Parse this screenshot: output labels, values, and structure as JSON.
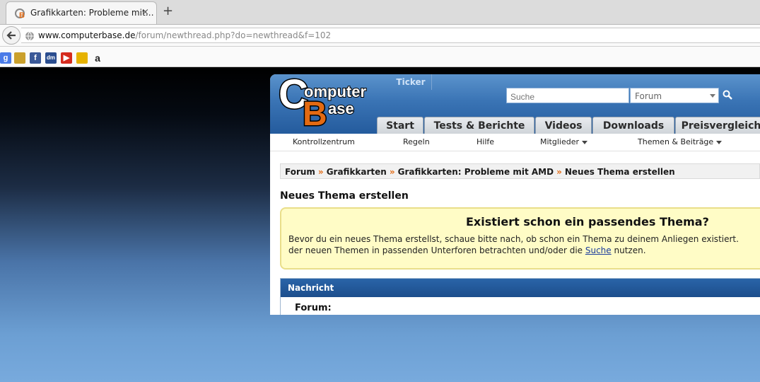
{
  "browser": {
    "tab_title": "Grafikkarten: Probleme mit…",
    "tab_close": "×",
    "new_tab": "+",
    "url_host": "www.computerbase.de",
    "url_path": "/forum/newthread.php?do=newthread&f=102",
    "bookmarks": [
      {
        "name": "google",
        "glyph": "g",
        "color": "#4a7be8"
      },
      {
        "name": "museum",
        "glyph": "",
        "color": "#caa02c"
      },
      {
        "name": "facebook",
        "glyph": "f",
        "color": "#3b5998"
      },
      {
        "name": "dm",
        "glyph": "dm",
        "color": "#2a4d8f"
      },
      {
        "name": "youtube",
        "glyph": "▶",
        "color": "#d52b1e"
      },
      {
        "name": "shop",
        "glyph": "",
        "color": "#e6b200"
      },
      {
        "name": "amazon",
        "glyph": "a",
        "color": "#222222"
      }
    ]
  },
  "site": {
    "logo_line1": "omputer",
    "logo_line2": "ase",
    "ticker": "Ticker",
    "search_placeholder": "Suche",
    "search_scope": "Forum",
    "nav_tabs": [
      "Start",
      "Tests & Berichte",
      "Videos",
      "Downloads",
      "Preisvergleich"
    ],
    "subnav": [
      "Kontrollzentrum",
      "Regeln",
      "Hilfe",
      "Mitglieder",
      "Themen & Beiträge"
    ],
    "breadcrumb": [
      "Forum",
      "Grafikkarten",
      "Grafikkarten: Probleme mit AMD",
      "Neues Thema erstellen"
    ],
    "breadcrumb_sep": "»",
    "page_title": "Neues Thema erstellen",
    "notice": {
      "title": "Existiert schon ein passendes Thema?",
      "line1": "Bevor du ein neues Thema erstellst, schaue bitte nach, ob schon ein Thema zu deinem Anliegen existiert.",
      "line2_before": "der neuen Themen in passenden Unterforen betrachten und/oder die ",
      "line2_link": "Suche",
      "line2_after": " nutzen."
    },
    "message_header": "Nachricht",
    "forum_label": "Forum:"
  },
  "colors": {
    "accent": "#e36a12",
    "brand_blue": "#245b9d"
  }
}
